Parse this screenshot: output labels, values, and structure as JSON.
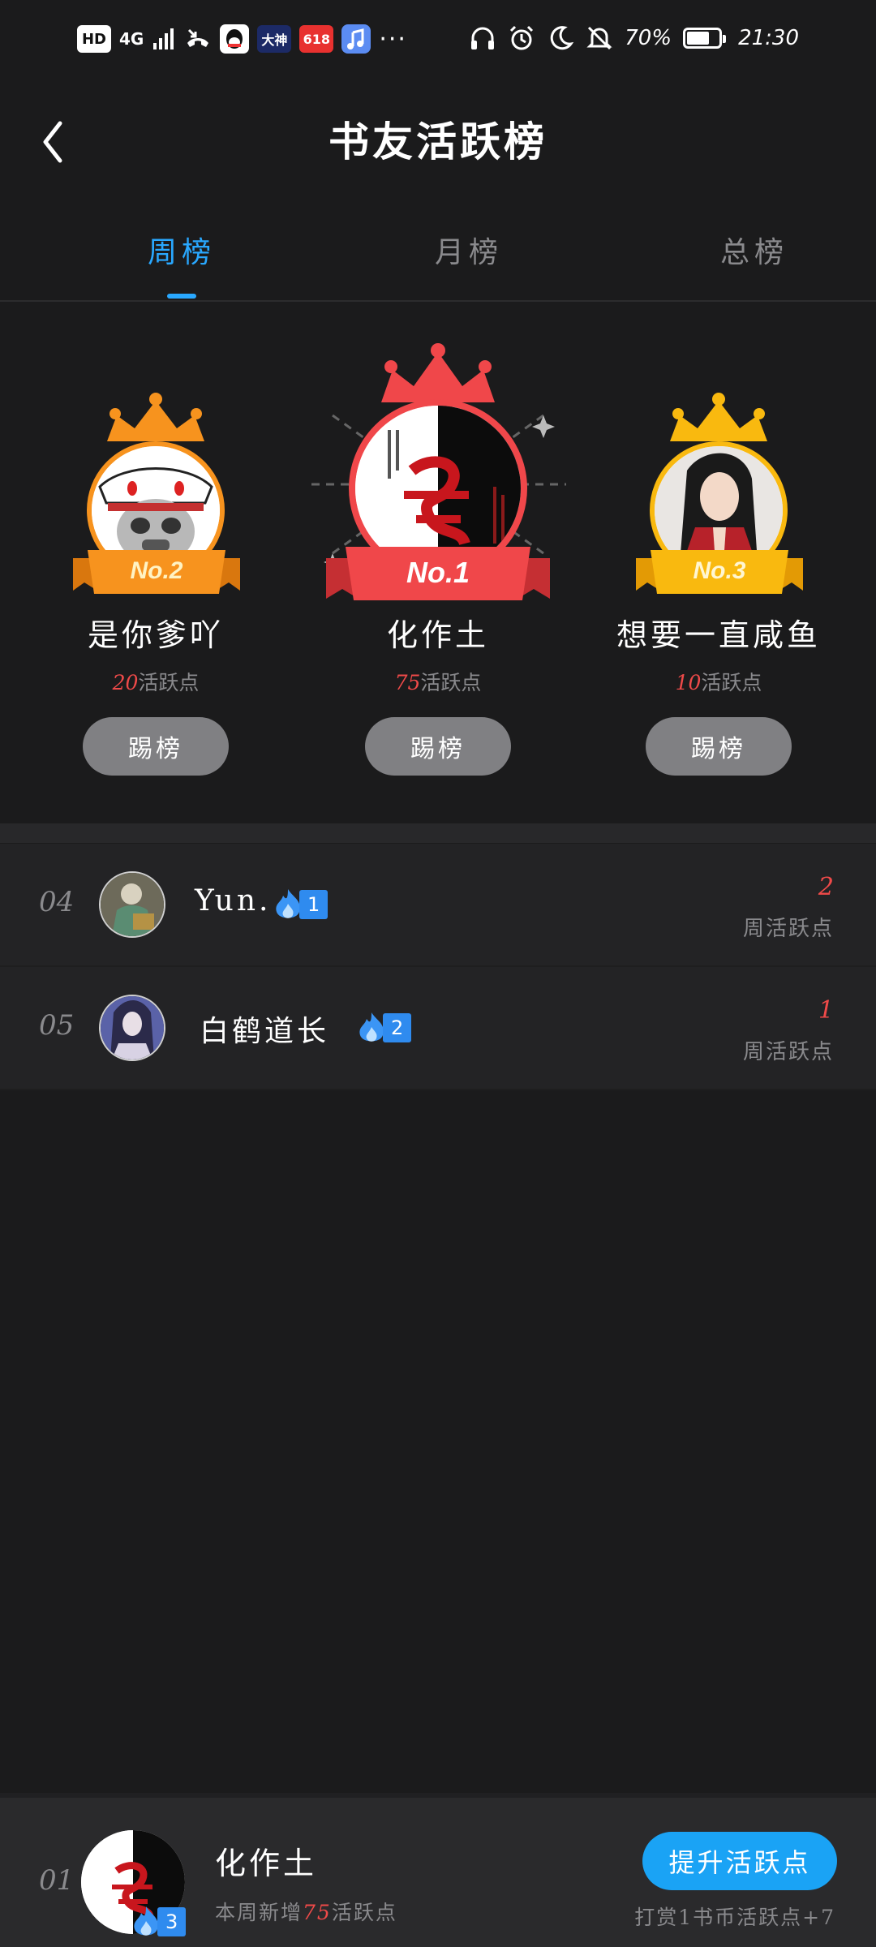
{
  "status_bar": {
    "hd": "HD",
    "network": "4G",
    "app_badge_1": "大神",
    "app_badge_2": "618",
    "more": "···",
    "battery": "70%",
    "battery_level": 0.7,
    "time": "21:30"
  },
  "header": {
    "title": "书友活跃榜"
  },
  "tabs": [
    {
      "label": "周榜",
      "active": true
    },
    {
      "label": "月榜",
      "active": false
    },
    {
      "label": "总榜",
      "active": false
    }
  ],
  "podium": {
    "first": {
      "rank_label": "No.1",
      "name": "化作土",
      "points": "75",
      "points_suffix": "活跃点",
      "button": "踢榜"
    },
    "second": {
      "rank_label": "No.2",
      "name": "是你爹吖",
      "points": "20",
      "points_suffix": "活跃点",
      "button": "踢榜"
    },
    "third": {
      "rank_label": "No.3",
      "name": "想要一直咸鱼",
      "points": "10",
      "points_suffix": "活跃点",
      "button": "踢榜"
    }
  },
  "list": [
    {
      "rank": "04",
      "name": "Yun.",
      "fire_level": "1",
      "score": "2",
      "score_label": "周活跃点"
    },
    {
      "rank": "05",
      "name": "白鹤道长",
      "fire_level": "2",
      "score": "1",
      "score_label": "周活跃点"
    }
  ],
  "me": {
    "rank": "01",
    "name": "化作土",
    "fire_level": "3",
    "sub_prefix": "本周新增",
    "sub_points": "75",
    "sub_suffix": "活跃点",
    "button": "提升活跃点",
    "tip": "打赏1书币活跃点+7"
  },
  "colors": {
    "background": "#1b1b1c",
    "accent_blue": "#29a8ff",
    "points_red": "#ef4a49",
    "crown_red": "#f0474a",
    "crown_orange": "#f7931e",
    "crown_yellow": "#f9b90f"
  }
}
